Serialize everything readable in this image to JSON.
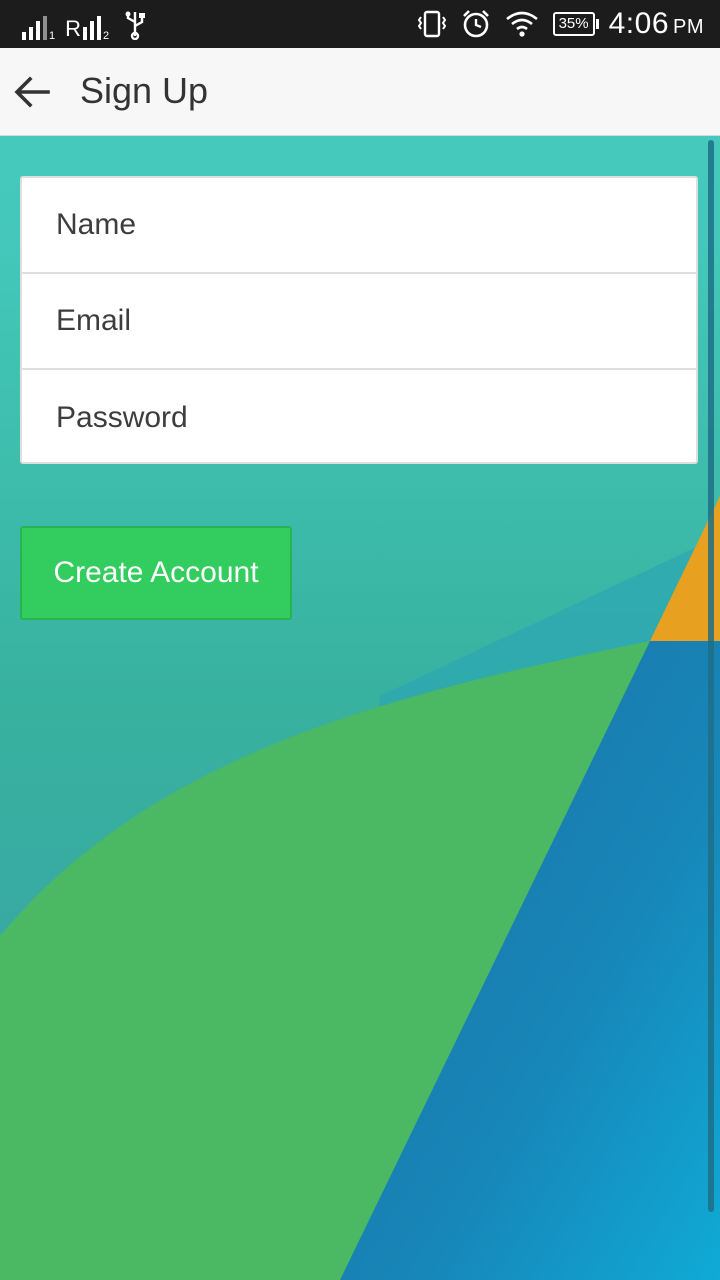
{
  "status_bar": {
    "sim1_index": "1",
    "sim2_label": "R",
    "sim2_index": "2",
    "battery": "35%",
    "time": "4:06",
    "ampm": "PM",
    "icons": [
      "signal-icon",
      "roaming-signal-icon",
      "usb-icon",
      "vibrate-icon",
      "alarm-icon",
      "wifi-icon",
      "battery-icon"
    ]
  },
  "app_bar": {
    "title": "Sign Up",
    "back_icon": "back-arrow-icon"
  },
  "form": {
    "name_placeholder": "Name",
    "email_placeholder": "Email",
    "password_placeholder": "Password"
  },
  "actions": {
    "create_account_label": "Create Account"
  },
  "colors": {
    "button_green": "#33cd5f",
    "status_bar": "#1c1c1c",
    "app_bar": "#f7f7f7"
  }
}
